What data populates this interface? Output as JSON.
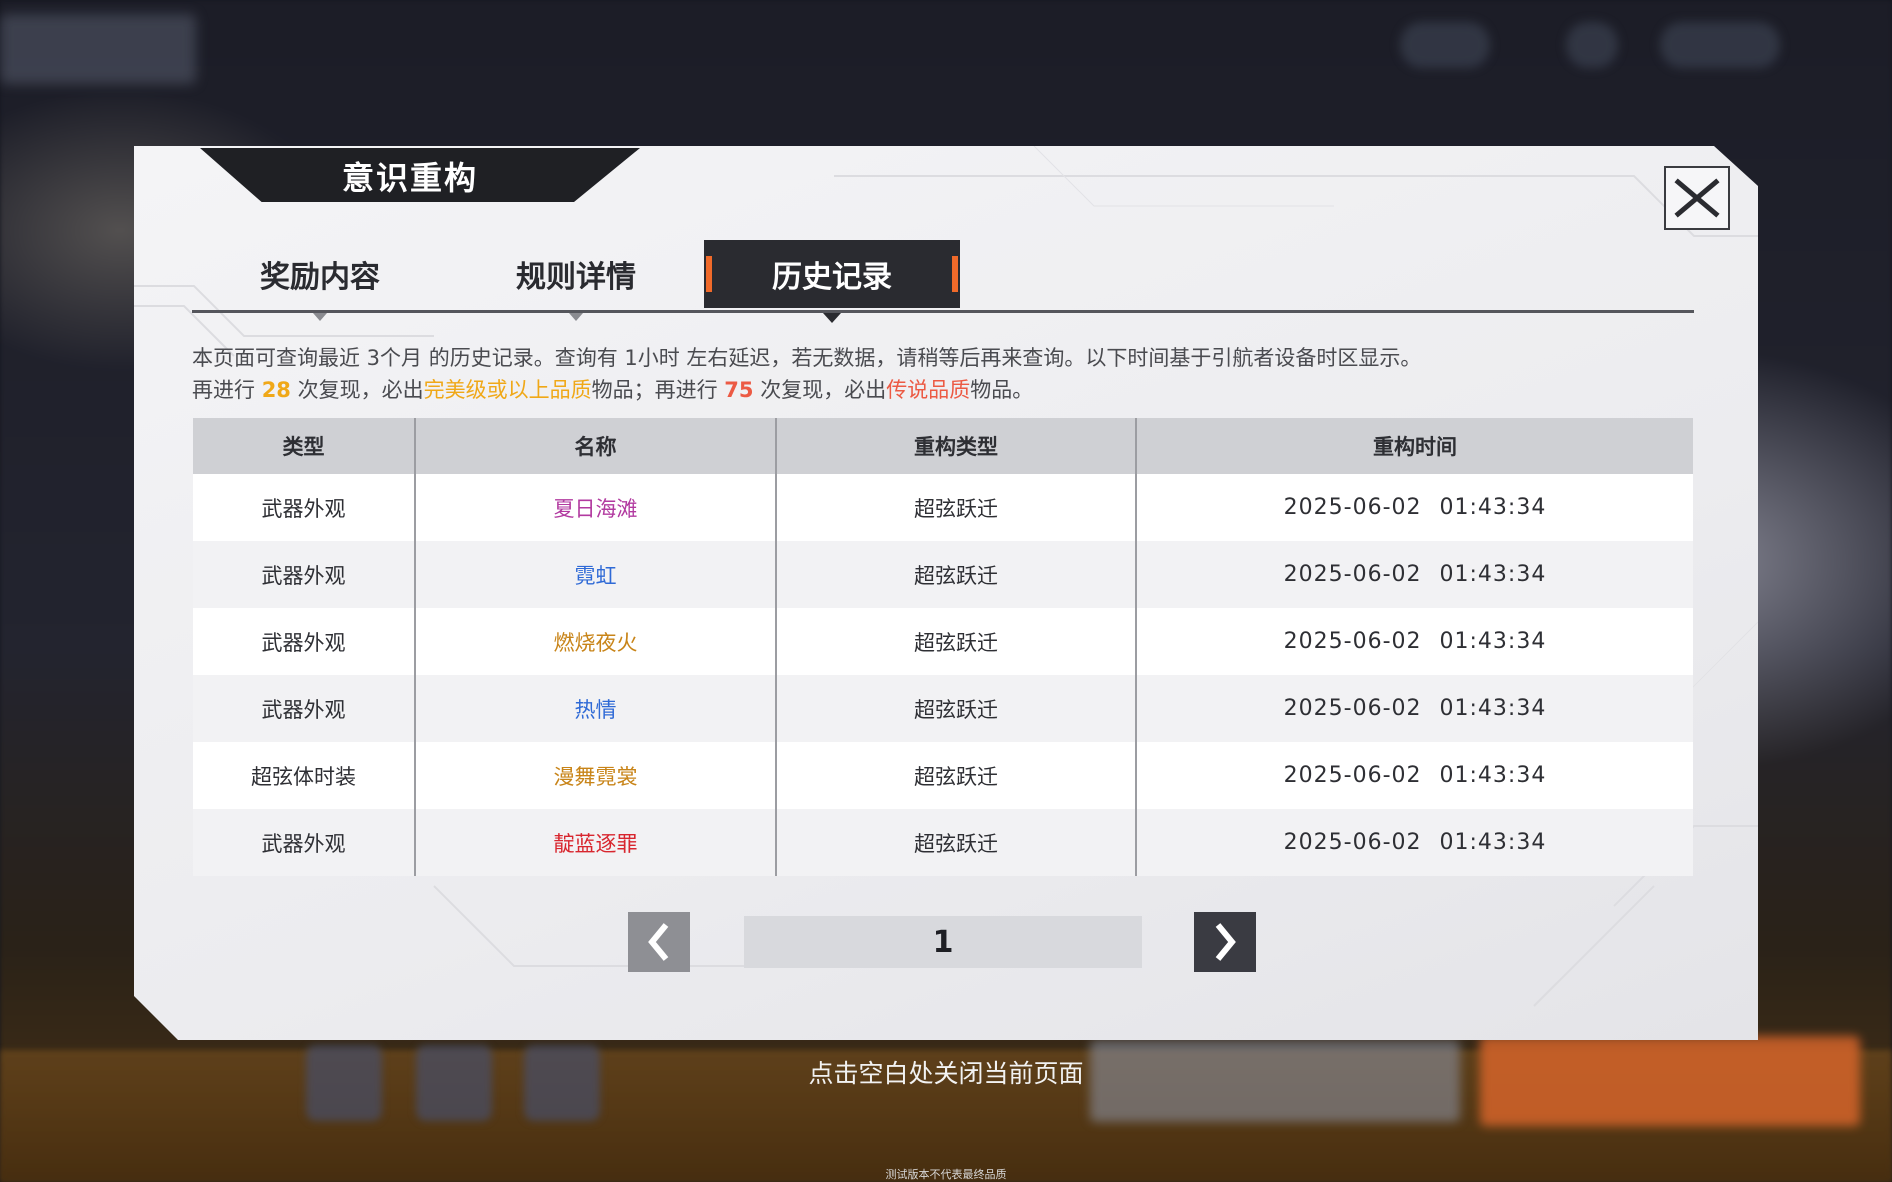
{
  "header": {
    "title": "意识重构",
    "close_label": "close"
  },
  "tabs": [
    {
      "label": "奖励内容",
      "active": false
    },
    {
      "label": "规则详情",
      "active": false
    },
    {
      "label": "历史记录",
      "active": true
    }
  ],
  "notice": {
    "line1": "本页面可查询最近 3个月 的历史记录。查询有 1小时 左右延迟，若无数据，请稍等后再来查询。以下时间基于引航者设备时区显示。",
    "line2_p1": "再进行 ",
    "line2_count1": "28",
    "line2_p2": " 次复现，必出",
    "line2_tier1": "完美级或以上品质",
    "line2_p3": "物品；再进行 ",
    "line2_count2": "75",
    "line2_p4": " 次复现，必出",
    "line2_tier2": "传说品质",
    "line2_p5": "物品。"
  },
  "table": {
    "headers": [
      "类型",
      "名称",
      "重构类型",
      "重构时间"
    ],
    "rows": [
      {
        "type": "武器外观",
        "name": "夏日海滩",
        "name_color": "#b23aa0",
        "mode": "超弦跃迁",
        "time": "2025-06-02 01:43:34"
      },
      {
        "type": "武器外观",
        "name": "霓虹",
        "name_color": "#2f6ad6",
        "mode": "超弦跃迁",
        "time": "2025-06-02 01:43:34"
      },
      {
        "type": "武器外观",
        "name": "燃烧夜火",
        "name_color": "#c88418",
        "mode": "超弦跃迁",
        "time": "2025-06-02 01:43:34"
      },
      {
        "type": "武器外观",
        "name": "热情",
        "name_color": "#2f6ad6",
        "mode": "超弦跃迁",
        "time": "2025-06-02 01:43:34"
      },
      {
        "type": "超弦体时装",
        "name": "漫舞霓裳",
        "name_color": "#c88418",
        "mode": "超弦跃迁",
        "time": "2025-06-02 01:43:34"
      },
      {
        "type": "武器外观",
        "name": "靛蓝逐罪",
        "name_color": "#d8262e",
        "mode": "超弦跃迁",
        "time": "2025-06-02 01:43:34"
      }
    ]
  },
  "pagination": {
    "current": "1"
  },
  "footer": {
    "close_hint": "点击空白处关闭当前页面",
    "watermark": "测试版本不代表最终品质"
  },
  "colors": {
    "accent_orange": "#f06a2a",
    "gold": "#f0a818",
    "red": "#ec5a44"
  }
}
